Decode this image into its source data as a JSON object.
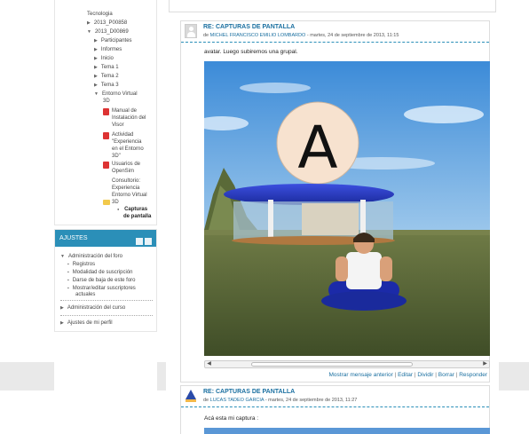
{
  "sidebar": {
    "tree": [
      {
        "label": "Tecnologia"
      },
      {
        "label": "2013_P00858"
      },
      {
        "label": "2013_D00869"
      },
      {
        "label": "Participantes"
      },
      {
        "label": "Informes"
      },
      {
        "label": "Inicio"
      },
      {
        "label": "Tema 1"
      },
      {
        "label": "Tema 2"
      },
      {
        "label": "Tema 3"
      },
      {
        "label": "Entorno Virtual",
        "label2": "3D"
      },
      {
        "label": "Manual de",
        "label2": "Instalación del",
        "label3": "Visor"
      },
      {
        "label": "Actividad",
        "label2": "\"Experiencia",
        "label3": "en el Entorno",
        "label4": "3D\""
      },
      {
        "label": "Usuarios de",
        "label2": "OpenSim"
      },
      {
        "label": "Consultorio:",
        "label2": "Experiencia",
        "label3": "Entorno Virtual",
        "label4": "3D"
      },
      {
        "label": "Capturas",
        "label2": "de pantalla"
      }
    ],
    "ajustes": {
      "title": "AJUSTES",
      "items": [
        {
          "label": "Administración del foro"
        },
        {
          "label": "Registros"
        },
        {
          "label": "Modalidad de suscripción"
        },
        {
          "label": "Darse de baja de este foro"
        },
        {
          "label": "Mostrar/editar suscriptores",
          "label2": "actuales"
        },
        {
          "label": "Administración del curso"
        },
        {
          "label": "Ajustes de mi perfil"
        }
      ]
    }
  },
  "posts": [
    {
      "title": "RE: CAPTURAS DE PANTALLA",
      "meta_prefix": "de",
      "author": "MICHEL FRANCISCO EMILIO LOMBARDO",
      "date": "- martes, 24 de septiembre de 2013, 11:15",
      "text": "avatar. Luego subiremos una grupal.",
      "links": [
        "Mostrar mensaje anterior",
        "Editar",
        "Dividir",
        "Borrar",
        "Responder"
      ],
      "image_letter": "A"
    },
    {
      "title": "RE: CAPTURAS DE PANTALLA",
      "meta_prefix": "de",
      "author": "LUCAS TADEO GARCIA",
      "date": "- martes, 24 de septiembre de 2013, 11:27",
      "text": "Acá esta mi captura :"
    }
  ],
  "colors": {
    "accent": "#2b8fb8",
    "link": "#1a6fa0",
    "pdf_icon": "#dd3333"
  }
}
